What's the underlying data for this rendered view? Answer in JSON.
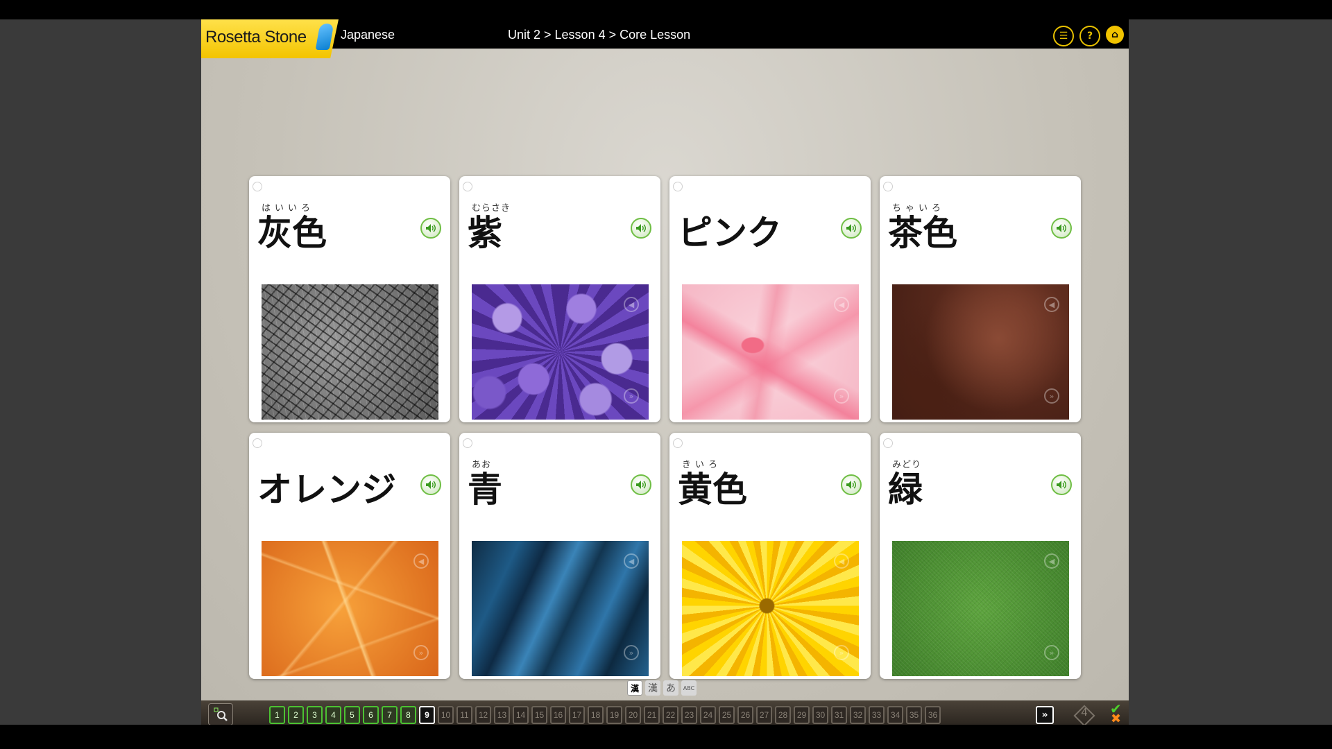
{
  "header": {
    "logo_text": "Rosetta Stone",
    "language": "Japanese",
    "breadcrumb": "Unit 2 > Lesson 4 > Core Lesson",
    "menu_icon": "list-menu-icon",
    "help_icon": "help-icon",
    "home_icon": "home-icon"
  },
  "cards": [
    {
      "reading": "はいいろ",
      "word": "灰色",
      "image": "elephant-skin-gray-texture"
    },
    {
      "reading": "むらさき",
      "word": "紫",
      "image": "purple-flowers"
    },
    {
      "reading": "",
      "word": "ピンク",
      "image": "pink-ribbon-bow"
    },
    {
      "reading": "ちゃいろ",
      "word": "茶色",
      "image": "brown-leather"
    },
    {
      "reading": "",
      "word": "オレンジ",
      "image": "orange-leaf"
    },
    {
      "reading": "あお",
      "word": "青",
      "image": "blue-silk"
    },
    {
      "reading": "きいろ",
      "word": "黄色",
      "image": "yellow-flower"
    },
    {
      "reading": "みどり",
      "word": "緑",
      "image": "green-grass"
    }
  ],
  "script_modes": [
    {
      "label": "漢",
      "active": true
    },
    {
      "label": "漢",
      "active": false
    },
    {
      "label": "あ",
      "active": false
    },
    {
      "label": "ABC",
      "active": false
    }
  ],
  "pages": {
    "numbers": [
      "1",
      "2",
      "3",
      "4",
      "5",
      "6",
      "7",
      "8",
      "9",
      "10",
      "11",
      "12",
      "13",
      "14",
      "15",
      "16",
      "17",
      "18",
      "19",
      "20",
      "21",
      "22",
      "23",
      "24",
      "25",
      "26",
      "27",
      "28",
      "29",
      "30",
      "31",
      "32",
      "33",
      "34",
      "35",
      "36"
    ],
    "completed": 8,
    "current": 9,
    "next_label": "»"
  },
  "attempts": "4",
  "colors": {
    "accent_yellow": "#f3c400",
    "correct_green": "#4cc233",
    "wrong_orange": "#ff8a1a"
  }
}
